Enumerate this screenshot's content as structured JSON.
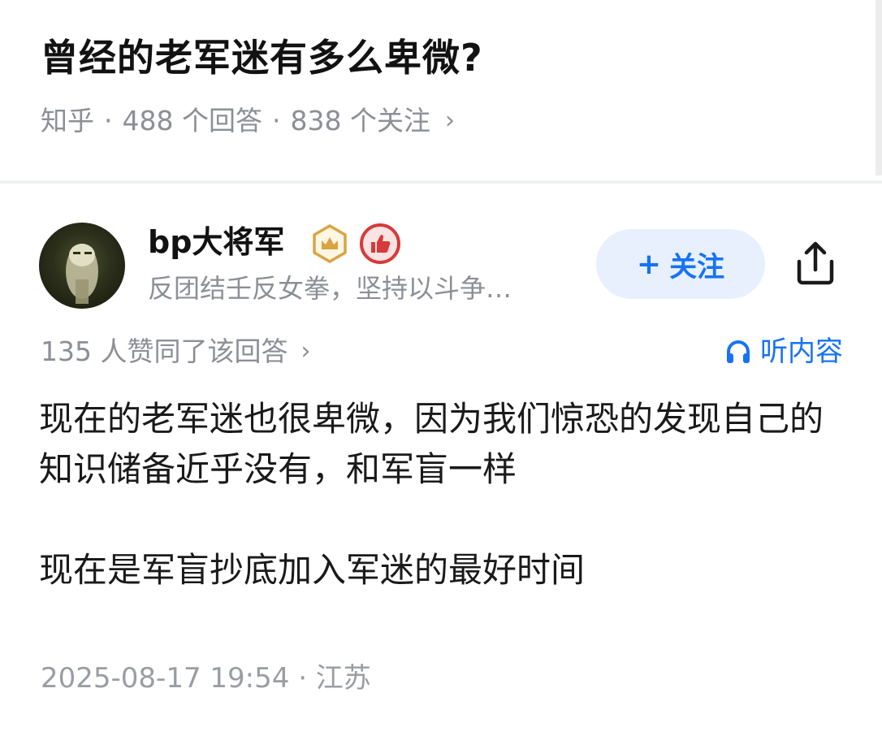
{
  "question": {
    "title": "曾经的老军迷有多么卑微?",
    "source": "知乎",
    "separator": "·",
    "answers_count": "488 个回答",
    "followers_count": "838 个关注",
    "chevron": "›"
  },
  "answer": {
    "author": {
      "name": "bp大将军",
      "bio": "反团结壬反女拳，坚持以斗争…",
      "badges": [
        "crown-badge-icon",
        "like-badge-icon"
      ]
    },
    "follow_button": {
      "plus": "+",
      "label": "关注"
    },
    "share_icon": "share-icon",
    "upvotes_text": "135 人赞同了该回答",
    "upvotes_chevron": "›",
    "listen_label": "听内容",
    "paragraph1": "现在的老军迷也很卑微，因为我们惊恐的发现自己的知识储备近乎没有，和军盲一样",
    "paragraph2": "现在是军盲抄底加入军迷的最好时间",
    "timestamp": "2025-08-17 19:54 · 江苏"
  },
  "colors": {
    "accent_blue": "#1772f6",
    "follow_bg": "#e8f0fd",
    "meta_gray": "#8c8f96",
    "crown_gold": "#d9a441",
    "like_red": "#d63a3a"
  }
}
